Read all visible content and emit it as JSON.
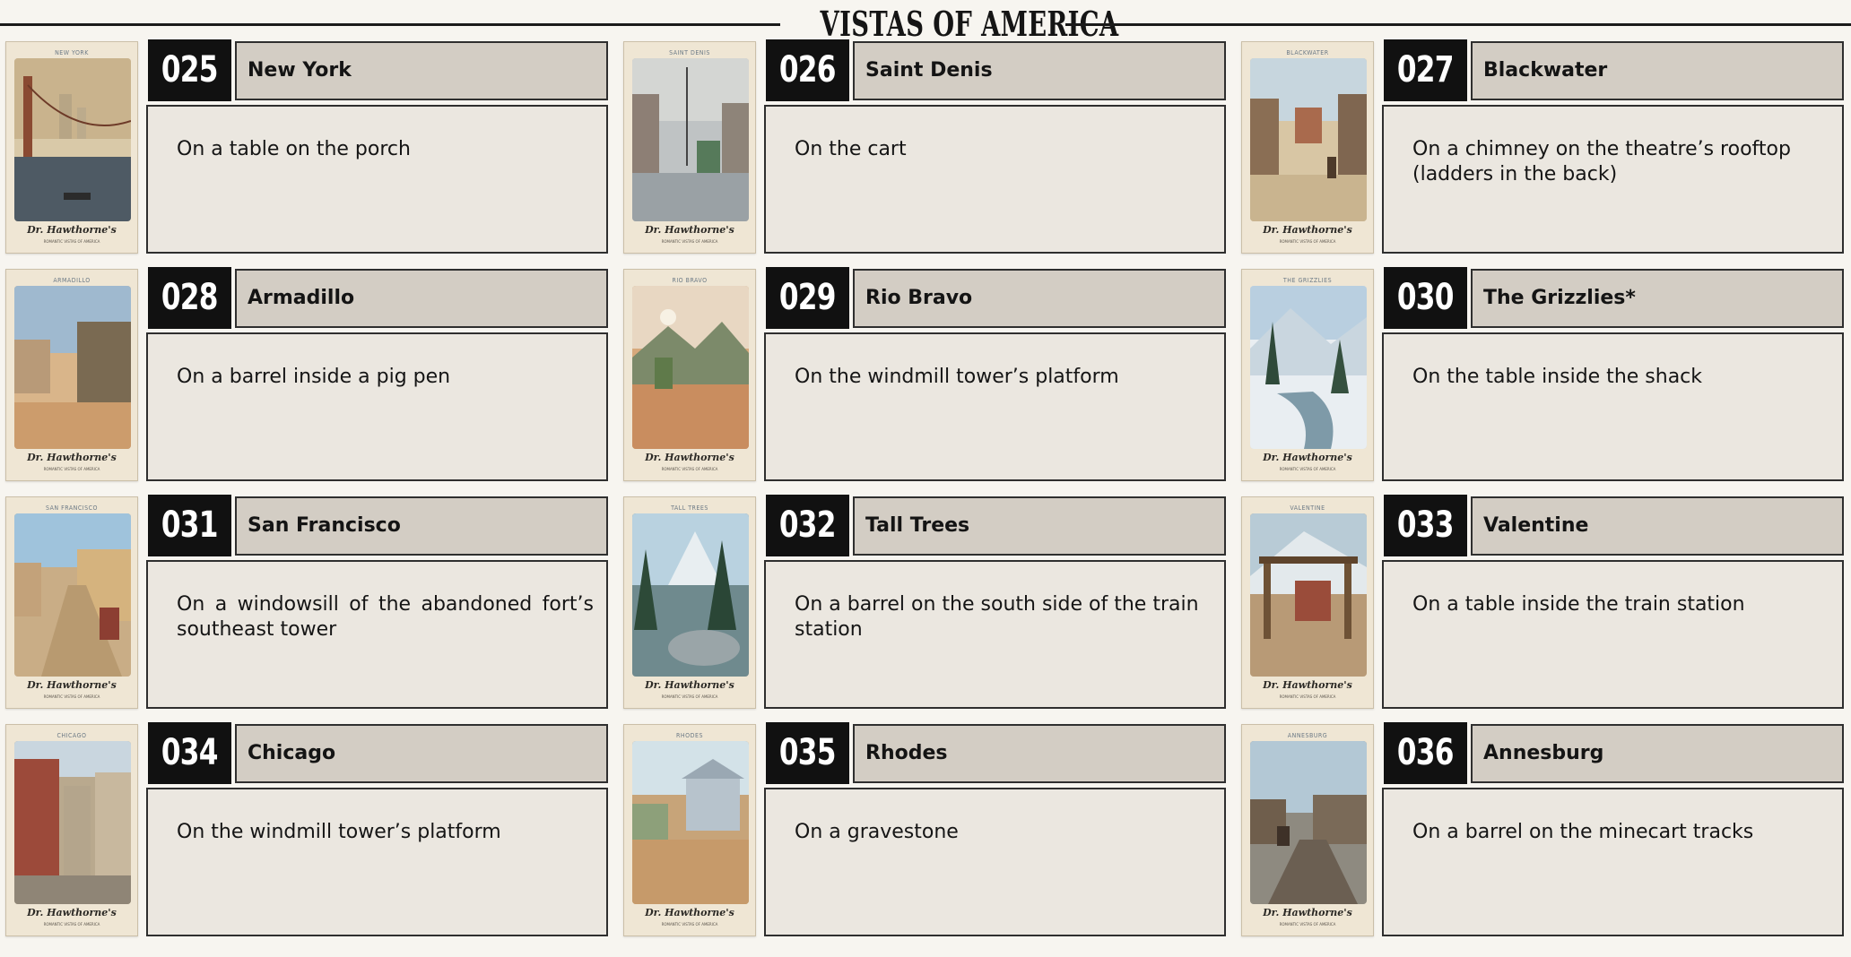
{
  "header": {
    "title": "VISTAS OF AMERICA"
  },
  "card": {
    "brand": "Dr. Hawthorne's",
    "brand_sub": "ROMANTIC VISTAS OF AMERICA"
  },
  "entries": [
    {
      "number": "025",
      "name": "New York",
      "card_title": "NEW YORK",
      "location": "On a table on the porch"
    },
    {
      "number": "026",
      "name": "Saint Denis",
      "card_title": "SAINT DENIS",
      "location": "On the cart"
    },
    {
      "number": "027",
      "name": "Blackwater",
      "card_title": "BLACKWATER",
      "location": "On a chimney on the theatre’s rooftop (ladders in the back)"
    },
    {
      "number": "028",
      "name": "Armadillo",
      "card_title": "ARMADILLO",
      "location": "On a barrel inside a pig pen"
    },
    {
      "number": "029",
      "name": "Rio Bravo",
      "card_title": "RIO BRAVO",
      "location": "On the windmill tower’s platform"
    },
    {
      "number": "030",
      "name": "The Grizzlies*",
      "card_title": "THE GRIZZLIES",
      "location": "On the table inside the shack"
    },
    {
      "number": "031",
      "name": "San Francisco",
      "card_title": "SAN FRANCISCO",
      "location": "On a windowsill of the abandoned fort’s southeast tower"
    },
    {
      "number": "032",
      "name": "Tall Trees",
      "card_title": "TALL TREES",
      "location": "On a barrel on the south side of the train station"
    },
    {
      "number": "033",
      "name": "Valentine",
      "card_title": "VALENTINE",
      "location": "On a table inside the train station"
    },
    {
      "number": "034",
      "name": "Chicago",
      "card_title": "CHICAGO",
      "location": "On the windmill tower’s platform"
    },
    {
      "number": "035",
      "name": "Rhodes",
      "card_title": "RHODES",
      "location": "On a gravestone"
    },
    {
      "number": "036",
      "name": "Annesburg",
      "card_title": "ANNESBURG",
      "location": "On a barrel on the minecart tracks"
    }
  ]
}
